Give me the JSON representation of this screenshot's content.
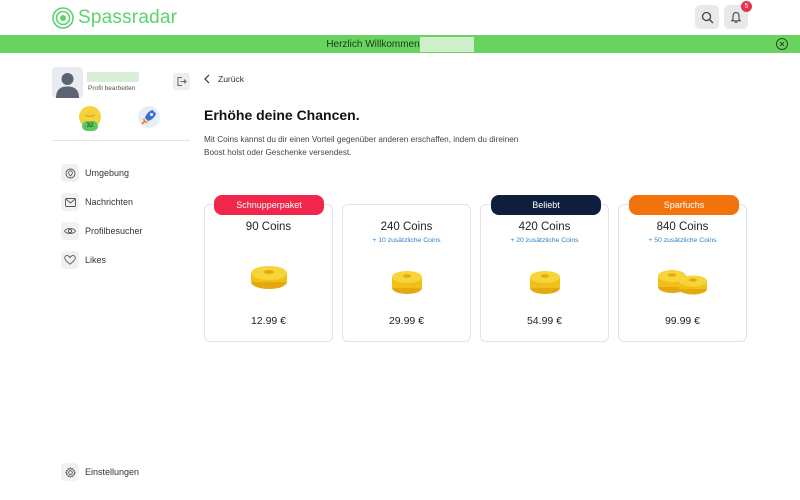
{
  "header": {
    "logo_text": "Spassradar",
    "notification_count": "5"
  },
  "welcome": {
    "text": "Herzlich Willkommen"
  },
  "sidebar": {
    "profile_edit": "Profil bearbeiten",
    "coin_count": "32",
    "nav": [
      {
        "label": "Umgebung",
        "icon": "map-pin-icon"
      },
      {
        "label": "Nachrichten",
        "icon": "mail-icon"
      },
      {
        "label": "Profilbesucher",
        "icon": "eye-icon"
      },
      {
        "label": "Likes",
        "icon": "heart-icon"
      }
    ],
    "settings": "Einstellungen"
  },
  "main": {
    "back": "Zurück",
    "title": "Erhöhe deine Chancen.",
    "description": "Mit Coins kannst du dir einen Vorteil gegenüber anderen erschaffen, indem du direinen Boost holst oder Geschenke versendest.",
    "packages": [
      {
        "ribbon": "Schnupperpaket",
        "ribbon_color": "#f0264a",
        "coins": "90 Coins",
        "bonus": "",
        "price": "12.99 €"
      },
      {
        "ribbon": "",
        "ribbon_color": "",
        "coins": "240 Coins",
        "bonus": "+ 10 zusätzliche Coins",
        "price": "29.99 €"
      },
      {
        "ribbon": "Beliebt",
        "ribbon_color": "#0e1e3d",
        "coins": "420 Coins",
        "bonus": "+ 20 zusätzliche Coins",
        "price": "54.99 €"
      },
      {
        "ribbon": "Sparfuchs",
        "ribbon_color": "#f2730c",
        "coins": "840 Coins",
        "bonus": "+ 50 zusätzliche Coins",
        "price": "99.99 €"
      }
    ]
  },
  "colors": {
    "brand": "#5bd36b",
    "welcome_bar": "#69d35f",
    "link": "#2f7fc8",
    "coin": "#f3cc1c"
  }
}
